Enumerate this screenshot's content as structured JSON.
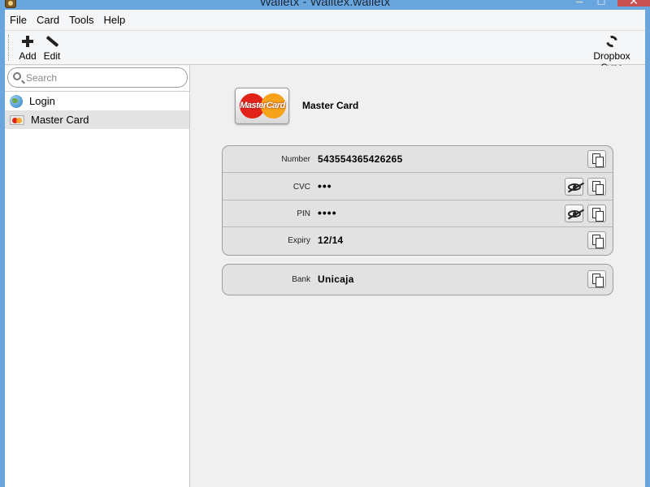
{
  "window": {
    "title": "Walletx - Walltex.walletx"
  },
  "menubar": {
    "items": [
      "File",
      "Card",
      "Tools",
      "Help"
    ]
  },
  "toolbar": {
    "add_label": "Add",
    "edit_label": "Edit",
    "sync_label": "Dropbox Sync"
  },
  "sidebar": {
    "search_placeholder": "Search",
    "items": [
      {
        "label": "Login",
        "icon": "globe-icon"
      },
      {
        "label": "Master Card",
        "icon": "mastercard-icon",
        "selected": true
      }
    ]
  },
  "card": {
    "name": "Master Card",
    "logo_text": "MasterCard",
    "fields": [
      {
        "label": "Number",
        "value": "543554365426265",
        "actions": [
          "copy"
        ]
      },
      {
        "label": "CVC",
        "value": "•••",
        "actions": [
          "reveal",
          "copy"
        ]
      },
      {
        "label": "PIN",
        "value": "••••",
        "actions": [
          "reveal",
          "copy"
        ]
      },
      {
        "label": "Expiry",
        "value": "12/14",
        "actions": [
          "copy"
        ]
      }
    ],
    "extra_fields": [
      {
        "label": "Bank",
        "value": "Unicaja",
        "actions": [
          "copy"
        ]
      }
    ]
  },
  "colors": {
    "titlebar": "#6aa6de",
    "mastercard_red": "#e2231a",
    "mastercard_orange": "#f7a21b",
    "close_button": "#c75050"
  }
}
